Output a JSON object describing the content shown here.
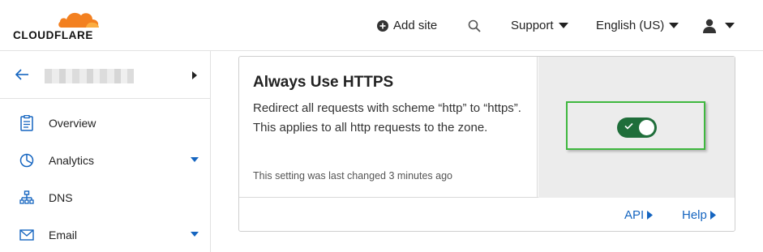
{
  "brand": {
    "name": "CLOUDFLARE",
    "accent": "#f38020",
    "accent_light": "#fbad41"
  },
  "header": {
    "add_site": "Add site",
    "support": "Support",
    "language": "English (US)"
  },
  "sidebar": {
    "zone_name": "",
    "items": [
      {
        "label": "Overview",
        "icon": "document-icon",
        "has_caret": false
      },
      {
        "label": "Analytics",
        "icon": "pie-chart-icon",
        "has_caret": true
      },
      {
        "label": "DNS",
        "icon": "network-icon",
        "has_caret": false
      },
      {
        "label": "Email",
        "icon": "envelope-icon",
        "has_caret": true
      }
    ]
  },
  "setting": {
    "title": "Always Use HTTPS",
    "description": "Redirect all requests with scheme “http” to “https”. This applies to all http requests to the zone.",
    "last_changed": "This setting was last changed 3 minutes ago",
    "enabled": true,
    "toggle_color": "#1f6e3a",
    "highlight_color": "#3fb83f"
  },
  "footer": {
    "api": "API",
    "help": "Help",
    "link_color": "#1565c0"
  }
}
